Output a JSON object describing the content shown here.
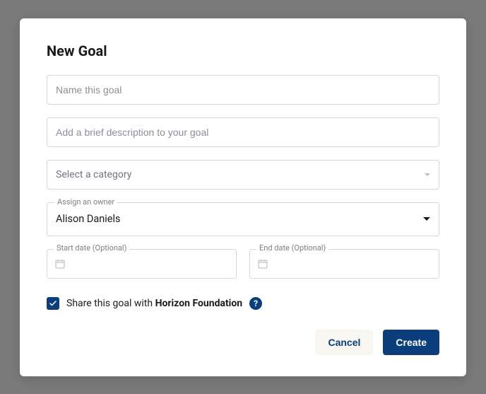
{
  "title": "New Goal",
  "name_placeholder": "Name this goal",
  "description_placeholder": "Add a brief description to your goal",
  "category_placeholder": "Select a category",
  "owner": {
    "label": "Assign an owner",
    "value": "Alison Daniels"
  },
  "start_date": {
    "label": "Start date (Optional)",
    "value": ""
  },
  "end_date": {
    "label": "End date (Optional)",
    "value": ""
  },
  "share": {
    "checked": true,
    "prefix": "Share this goal with ",
    "org": "Horizon Foundation"
  },
  "buttons": {
    "cancel": "Cancel",
    "create": "Create"
  },
  "colors": {
    "primary": "#0b3e7a"
  }
}
